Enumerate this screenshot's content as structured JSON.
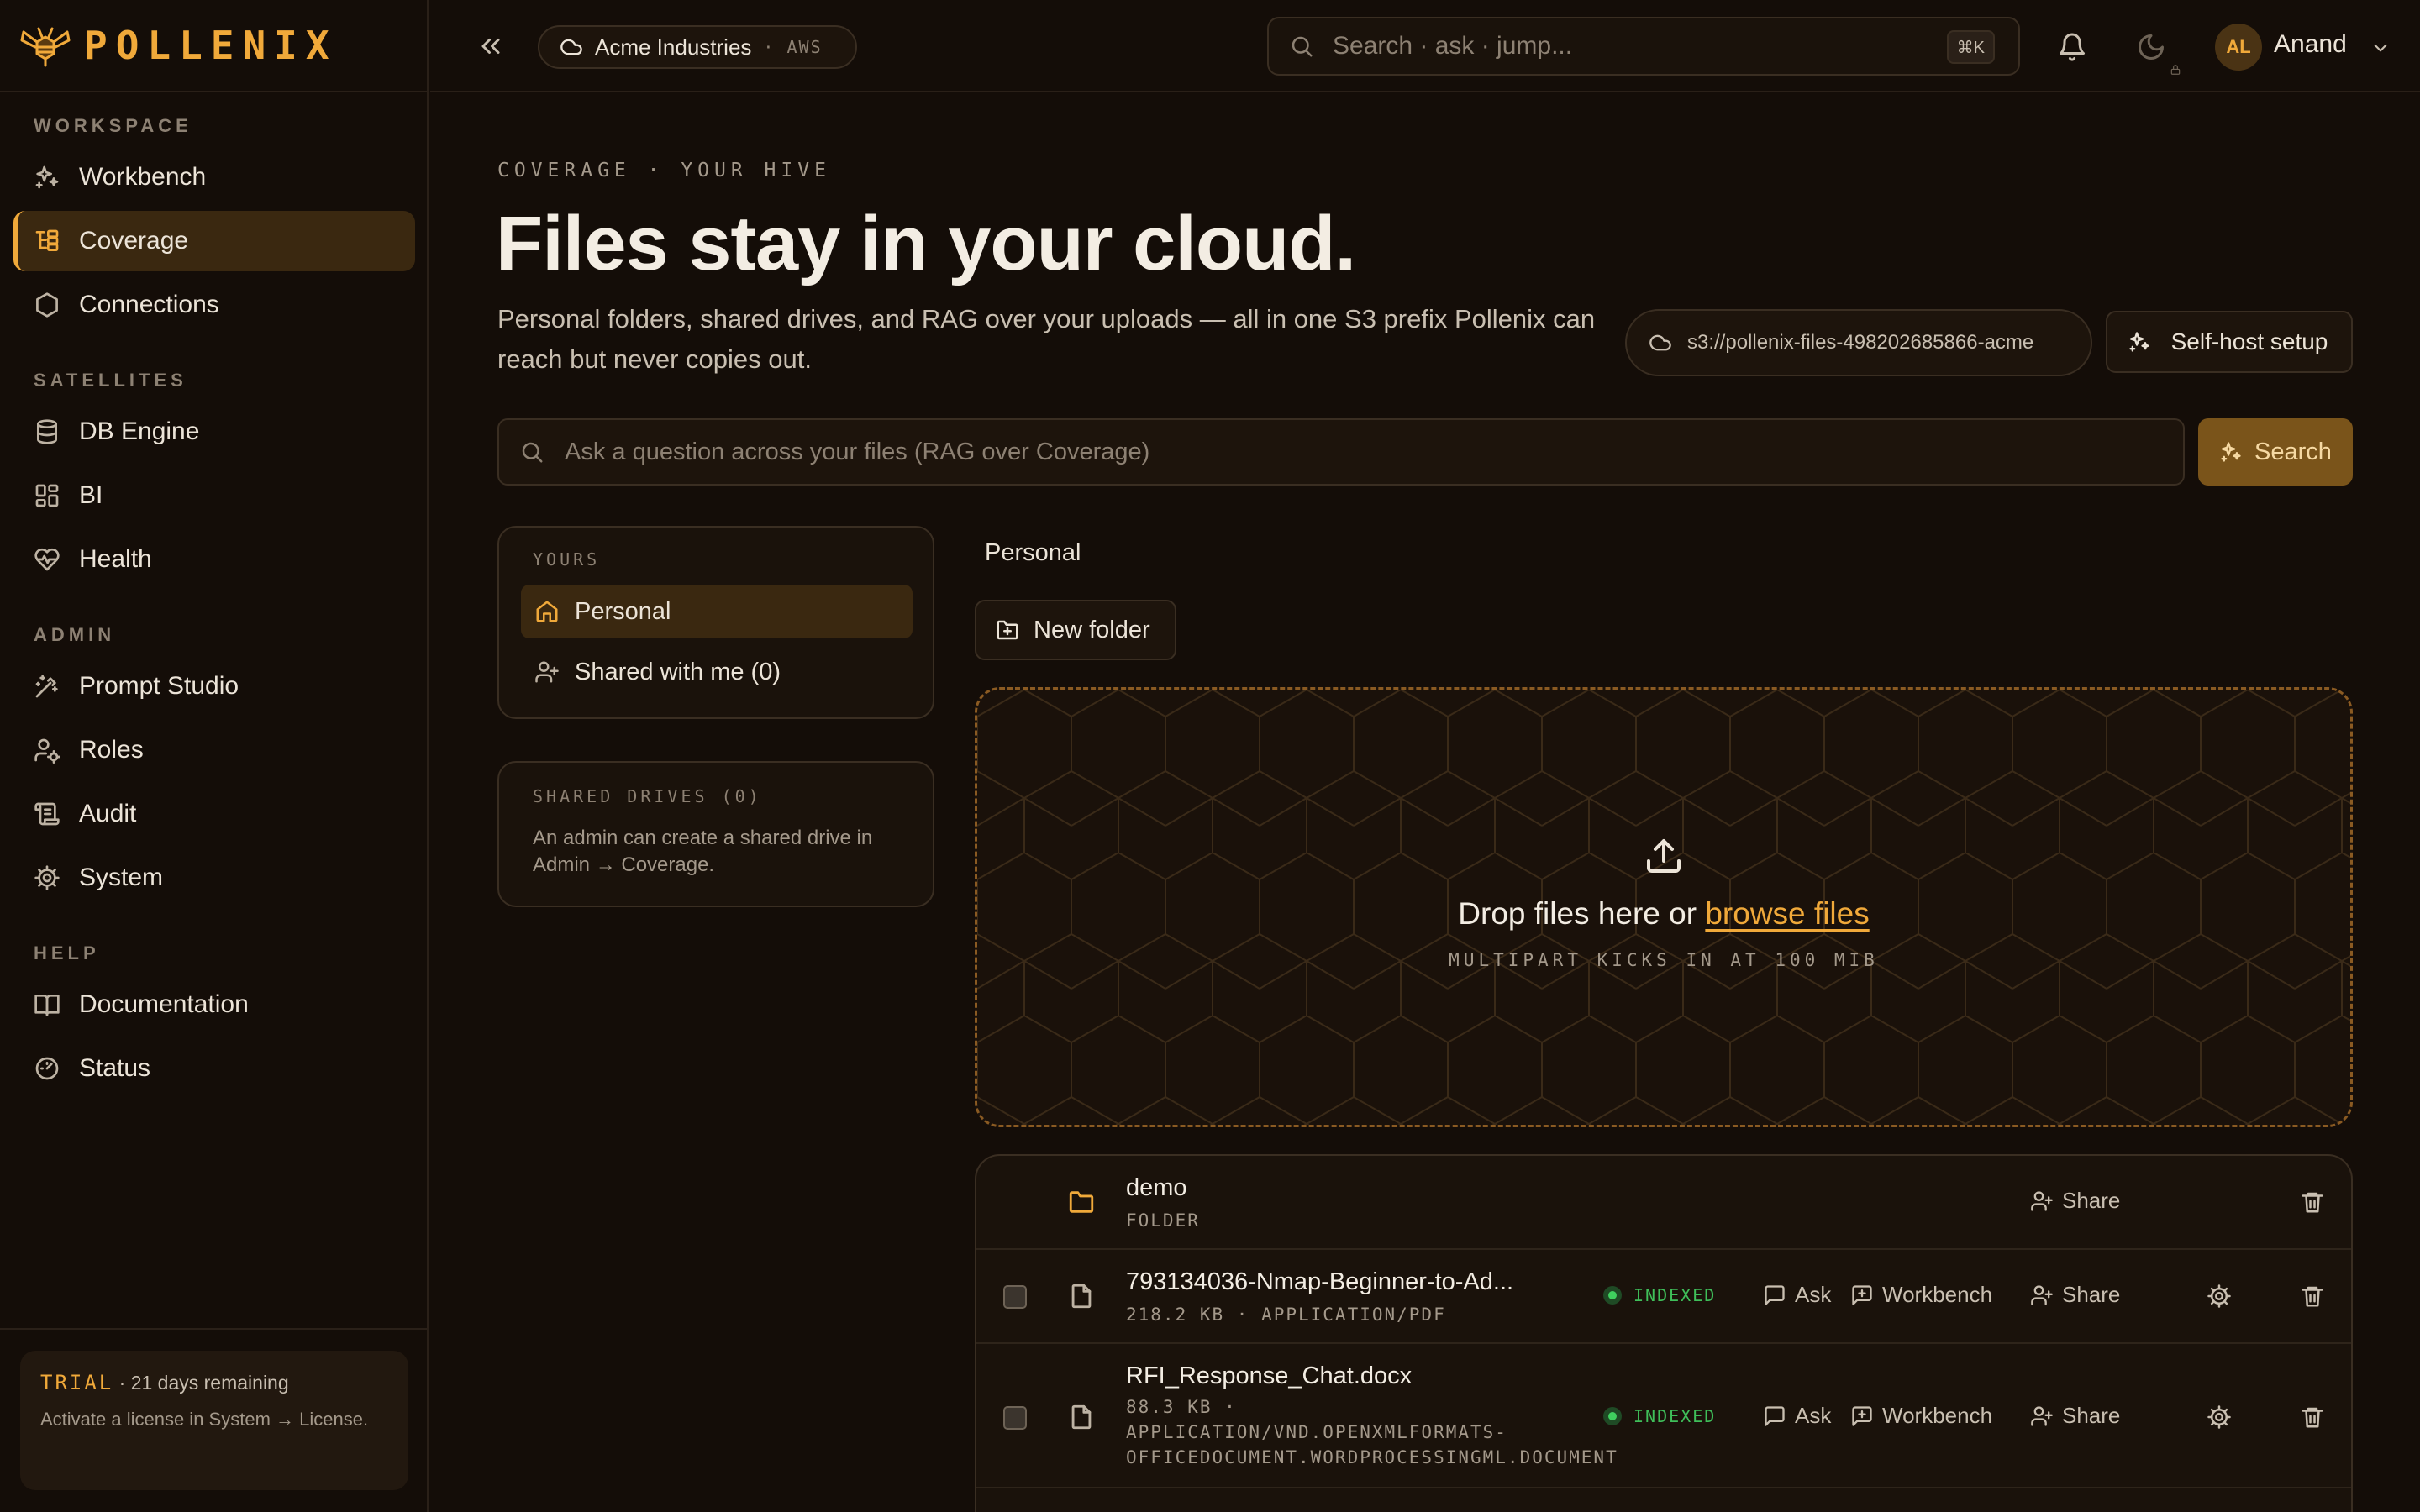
{
  "brand": {
    "name": "POLLENIX"
  },
  "sidebar": {
    "sections": [
      {
        "label": "WORKSPACE"
      },
      {
        "label": "SATELLITES"
      },
      {
        "label": "ADMIN"
      },
      {
        "label": "HELP"
      }
    ],
    "items": [
      {
        "label": "Workbench",
        "icon": "sparkles-icon"
      },
      {
        "label": "Coverage",
        "icon": "folder-tree-icon",
        "active": true
      },
      {
        "label": "Connections",
        "icon": "hexagon-icon"
      },
      {
        "label": "DB Engine",
        "icon": "database-icon"
      },
      {
        "label": "BI",
        "icon": "dashboard-icon"
      },
      {
        "label": "Health",
        "icon": "heart-pulse-icon"
      },
      {
        "label": "Prompt Studio",
        "icon": "wand-icon"
      },
      {
        "label": "Roles",
        "icon": "user-cog-icon"
      },
      {
        "label": "Audit",
        "icon": "scroll-icon"
      },
      {
        "label": "System",
        "icon": "cog-icon"
      },
      {
        "label": "Documentation",
        "icon": "book-icon"
      },
      {
        "label": "Status",
        "icon": "gauge-icon"
      }
    ],
    "trial": {
      "badge": "TRIAL",
      "remaining": "· 21 days remaining",
      "note": "Activate a license in System → License."
    }
  },
  "topbar": {
    "org_name": "Acme Industries",
    "org_cloud": "· AWS",
    "search_placeholder": "Search · ask · jump...",
    "shortcut": "⌘K",
    "user_initials": "AL",
    "user_name": "Anand"
  },
  "main": {
    "eyebrow": "COVERAGE · YOUR HIVE",
    "title": "Files stay in your cloud.",
    "subtitle": "Personal folders, shared drives, and RAG over your uploads — all in one S3 prefix Pollenix can reach but never copies out.",
    "bucket": "s3://pollenix-files-498202685866-acme",
    "selfhost_label": "Self-host setup",
    "rag_placeholder": "Ask a question across your files (RAG over Coverage)",
    "rag_button": "Search",
    "yours_label": "YOURS",
    "folders": [
      {
        "label": "Personal",
        "active": true
      },
      {
        "label": "Shared with me (0)"
      }
    ],
    "shared_drives_label": "SHARED DRIVES (0)",
    "shared_drives_note": "An admin can create a shared drive in Admin → Coverage.",
    "breadcrumb": "Personal",
    "new_folder_label": "New folder",
    "dropzone": {
      "text": "Drop files here or ",
      "link": "browse files",
      "hint": "MULTIPART KICKS IN AT 100 MIB"
    },
    "files": [
      {
        "name": "demo",
        "meta": "FOLDER",
        "type": "folder",
        "share": "Share"
      },
      {
        "name": "793134036-Nmap-Beginner-to-Ad...",
        "meta": "218.2 KB · APPLICATION/PDF",
        "type": "file",
        "status": "INDEXED",
        "ask": "Ask",
        "workbench": "Workbench",
        "share": "Share"
      },
      {
        "name": "RFI_Response_Chat.docx",
        "meta": "88.3 KB · APPLICATION/VND.OPENXMLFORMATS-OFFICEDOCUMENT.WORDPROCESSINGML.DOCUMENT",
        "type": "file",
        "status": "INDEXED",
        "ask": "Ask",
        "workbench": "Workbench",
        "share": "Share"
      }
    ]
  },
  "colors": {
    "accent": "#f0a93a",
    "background": "#140d08",
    "status_ok": "#3fcf5e"
  }
}
